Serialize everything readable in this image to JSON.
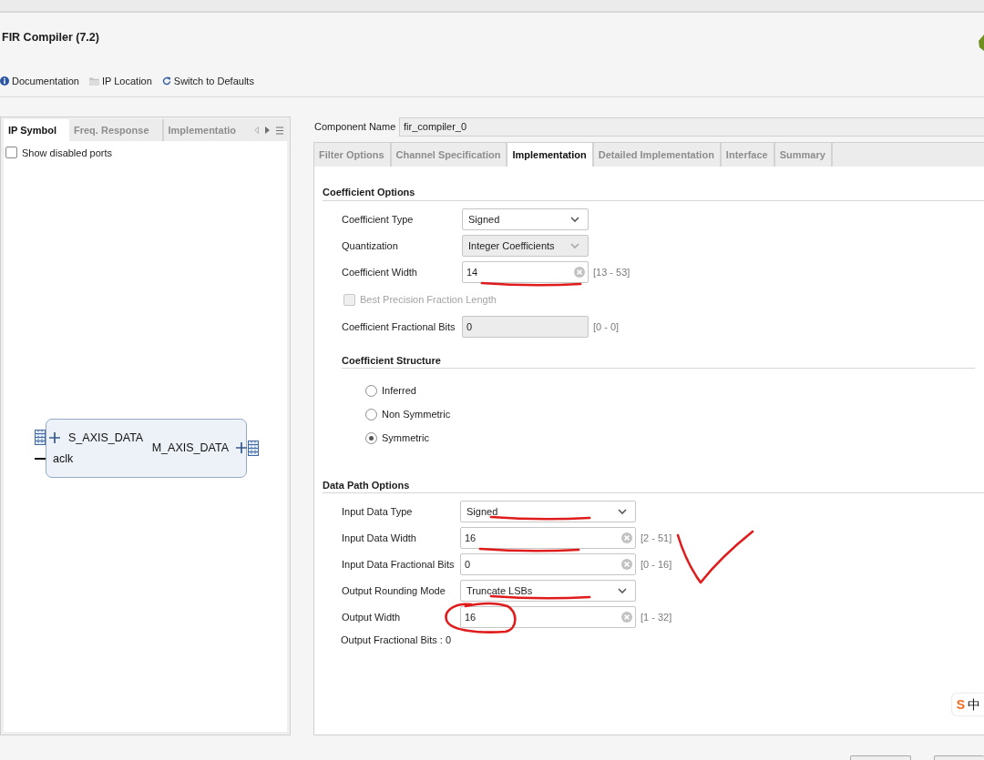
{
  "window": {
    "title": "FIR Compiler (7.2)"
  },
  "toolbar": [
    {
      "kind": "info",
      "label": "Documentation"
    },
    {
      "kind": "folder",
      "label": "IP Location"
    },
    {
      "kind": "refresh",
      "label": "Switch to Defaults"
    }
  ],
  "left_panel": {
    "tabs": [
      {
        "label": "IP Symbol",
        "selected": true
      },
      {
        "label": "Freq. Response",
        "selected": false
      },
      {
        "label": "Implementatio",
        "selected": false
      }
    ],
    "option": {
      "label": "Show disabled ports",
      "checked": false
    },
    "symbol": {
      "inputs": [
        {
          "kind": "bus",
          "label": "S_AXIS_DATA"
        },
        {
          "kind": "wire",
          "label": "aclk"
        }
      ],
      "outputs": [
        {
          "kind": "bus",
          "label": "M_AXIS_DATA"
        }
      ]
    }
  },
  "component_name": {
    "label": "Component Name",
    "value": "fir_compiler_0"
  },
  "tabs": [
    {
      "label": "Filter Options",
      "selected": false
    },
    {
      "label": "Channel Specification",
      "selected": false
    },
    {
      "label": "Implementation",
      "selected": true
    },
    {
      "label": "Detailed Implementation",
      "selected": false
    },
    {
      "label": "Interface",
      "selected": false
    },
    {
      "label": "Summary",
      "selected": false
    }
  ],
  "sections": [
    {
      "title": "Coefficient Options",
      "items": [
        {
          "kind": "dropdown",
          "label": "Coefficient Type",
          "value": "Signed",
          "disabled": false
        },
        {
          "kind": "dropdown",
          "label": "Quantization",
          "value": "Integer Coefficients",
          "disabled": true
        },
        {
          "kind": "number",
          "label": "Coefficient Width",
          "value": "14",
          "range": "[13 - 53]",
          "disabled": false,
          "annotation": {
            "kind": "underline"
          }
        },
        {
          "kind": "checkbox",
          "label": "Best Precision Fraction Length",
          "checked": false,
          "disabled": true
        },
        {
          "kind": "number",
          "label": "Coefficient Fractional Bits",
          "value": "0",
          "range": "[0 - 0]",
          "disabled": true
        }
      ],
      "group": {
        "title": "Coefficient Structure",
        "options": [
          {
            "label": "Inferred",
            "selected": false
          },
          {
            "label": "Non Symmetric",
            "selected": false
          },
          {
            "label": "Symmetric",
            "selected": true
          }
        ]
      }
    },
    {
      "title": "Data Path Options",
      "items": [
        {
          "kind": "dropdown",
          "label": "Input Data Type",
          "value": "Signed",
          "disabled": false,
          "annotation": {
            "kind": "underline"
          }
        },
        {
          "kind": "number",
          "label": "Input Data Width",
          "value": "16",
          "range": "[2 - 51]",
          "disabled": false,
          "annotation": {
            "kind": "underline"
          }
        },
        {
          "kind": "number",
          "label": "Input Data Fractional Bits",
          "value": "0",
          "range": "[0 - 16]",
          "disabled": false,
          "annotation": {
            "kind": "tick"
          }
        },
        {
          "kind": "dropdown",
          "label": "Output Rounding Mode",
          "value": "Truncate LSBs",
          "disabled": false,
          "annotation": {
            "kind": "underline"
          }
        },
        {
          "kind": "number",
          "label": "Output Width",
          "value": "16",
          "range": "[1 - 32]",
          "disabled": false,
          "annotation": {
            "kind": "circle"
          }
        },
        {
          "kind": "note",
          "label": "Output Fractional Bits : 0"
        }
      ]
    }
  ],
  "ime": {
    "logo": "S",
    "label": "中"
  }
}
